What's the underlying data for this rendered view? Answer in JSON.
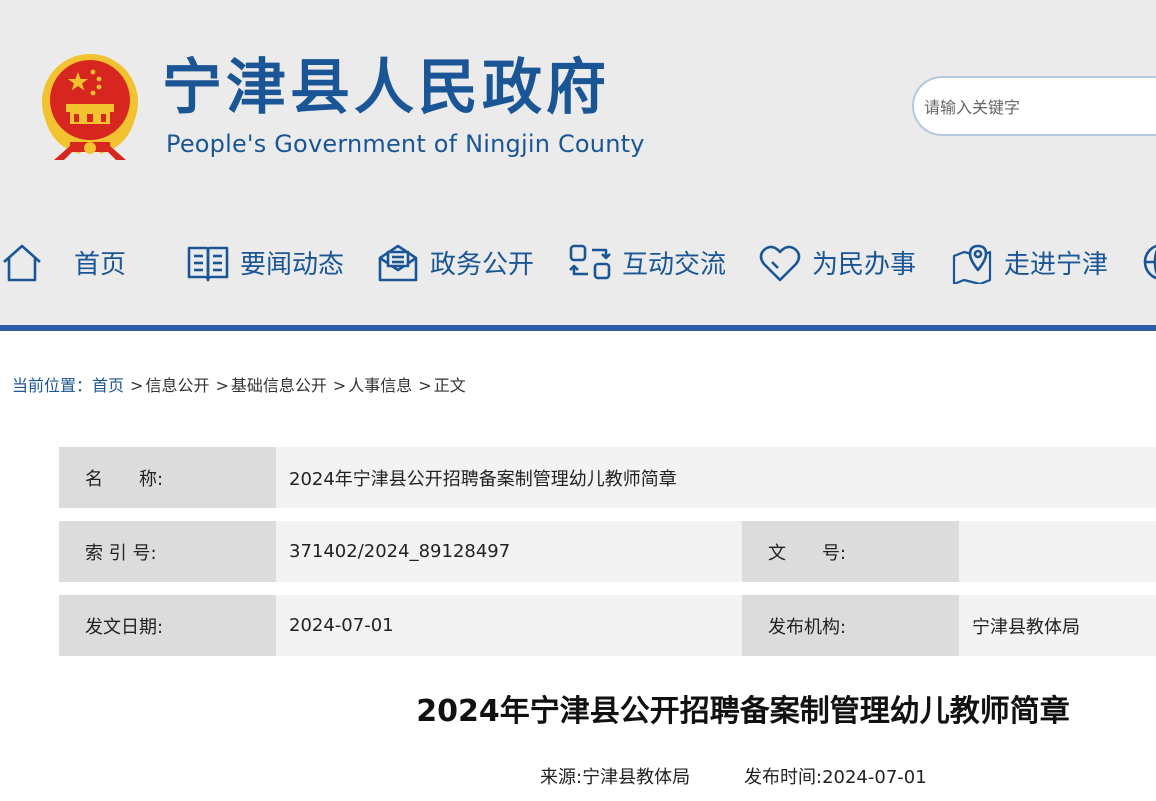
{
  "header": {
    "title": "宁津县人民政府",
    "subtitle": "People's Government of Ningjin County",
    "emblem_icon": "national-emblem-icon"
  },
  "search": {
    "placeholder": "请输入关键字"
  },
  "nav": {
    "items": [
      {
        "label": "首页",
        "icon": "home-icon"
      },
      {
        "label": "要闻动态",
        "icon": "book-icon"
      },
      {
        "label": "政务公开",
        "icon": "envelope-icon"
      },
      {
        "label": "互动交流",
        "icon": "exchange-icon"
      },
      {
        "label": "为民办事",
        "icon": "heart-icon"
      },
      {
        "label": "走进宁津",
        "icon": "map-pin-icon"
      }
    ],
    "bar_color": "#2f5da6"
  },
  "breadcrumb": {
    "lead": "当前位置：",
    "items": [
      "首页",
      "信息公开",
      "基础信息公开",
      "人事信息",
      "正文"
    ],
    "separator": ">"
  },
  "meta": {
    "name_label": "名　　称:",
    "name_value": "2024年宁津县公开招聘备案制管理幼儿教师简章",
    "index_label": "索 引 号:",
    "index_value": "371402/2024_89128497",
    "docno_label": "文　　号:",
    "docno_value": "",
    "date_label": "发文日期:",
    "date_value": "2024-07-01",
    "org_label": "发布机构:",
    "org_value": "宁津县教体局"
  },
  "article": {
    "title": "2024年宁津县公开招聘备案制管理幼儿教师简章",
    "source": "来源:宁津县教体局",
    "publish_time": "发布时间:2024-07-01"
  },
  "colors": {
    "brand": "#1a5696",
    "accent": "#2f5da6",
    "header_bg": "#ebebeb",
    "emblem_red": "#d7261f",
    "emblem_gold": "#f2c230"
  }
}
